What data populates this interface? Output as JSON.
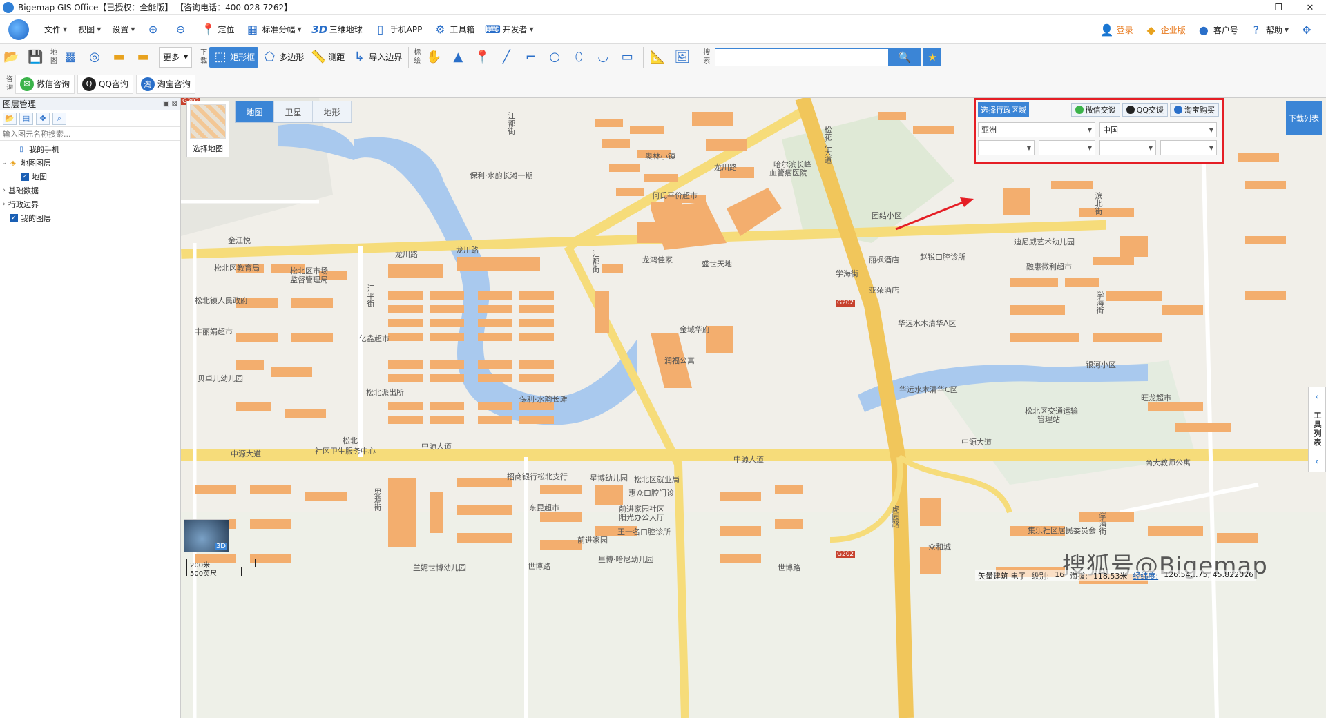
{
  "window": {
    "title": "Bigemap GIS Office【已授权：全能版】  【咨询电话：400-028-7262】",
    "buttons": [
      "—",
      "❐",
      "✕"
    ]
  },
  "menubar": {
    "items": [
      {
        "label": "文件",
        "caret": true
      },
      {
        "label": "视图",
        "caret": true
      },
      {
        "label": "设置",
        "caret": true
      }
    ],
    "tools": [
      {
        "icon": "zoom-in-icon",
        "label": ""
      },
      {
        "icon": "zoom-out-icon",
        "label": ""
      },
      {
        "icon": "location-icon",
        "label": "定位"
      },
      {
        "icon": "grid-icon",
        "label": "标准分幅"
      },
      {
        "icon": "3d-icon",
        "label": "三维地球"
      },
      {
        "icon": "phone-icon",
        "label": "手机APP"
      },
      {
        "icon": "gear-icon",
        "label": "工具箱"
      },
      {
        "icon": "code-icon",
        "label": "开发者"
      }
    ],
    "right": [
      "登录",
      "企业版",
      "客户号",
      "帮助"
    ]
  },
  "toolbar1": {
    "map_label": "地图",
    "more_label": "更多",
    "download_label": "下载",
    "mark_label": "标绘",
    "search_label": "搜索",
    "rect_label": "矩形框",
    "polygon_label": "多边形",
    "measure_label": "测距",
    "import_label": "导入边界",
    "search_placeholder": ""
  },
  "toolbar2": {
    "consult_label": "咨询",
    "wechat": "微信咨询",
    "qq": "QQ咨询",
    "taobao": "淘宝咨询"
  },
  "layer_panel": {
    "title": "图层管理",
    "search_placeholder": "输入图元名称搜索...",
    "tree": [
      {
        "label": "我的手机",
        "level": 1,
        "icon": "phone"
      },
      {
        "label": "地图图层",
        "level": 0,
        "icon": "layers",
        "expanded": true
      },
      {
        "label": "地图",
        "level": 2,
        "checked": true
      },
      {
        "label": "基础数据",
        "level": 0,
        "collapsed": true
      },
      {
        "label": "行政边界",
        "level": 0,
        "collapsed": true
      },
      {
        "label": "我的图层",
        "level": 0,
        "checked": true
      }
    ]
  },
  "map": {
    "choose_label": "选择地图",
    "tabs": [
      "地图",
      "卫星",
      "地形"
    ],
    "active_tab": "地图",
    "region": {
      "title": "选择行政区域",
      "wechat": "微信交谈",
      "qq": "QQ交谈",
      "taobao": "淘宝购买",
      "continent": "亚洲",
      "country": "中国"
    },
    "download_list": "下载列表",
    "tool_list": "工具列表",
    "globe_label": "3D",
    "scale_m": "200米",
    "scale_ft": "500英尺",
    "status": {
      "type": "矢量建筑 电子",
      "level_label": "级别:",
      "level": "16",
      "alt_label": "海拔:",
      "alt": "118.53米",
      "coord_label": "经纬度:",
      "coord": "126.54…75, 45.822026"
    },
    "watermark": "搜狐号@Bigemap",
    "labels": [
      "江都街",
      "保利·水韵长滩一期",
      "奥林小镇",
      "哈尔滨长峰",
      "血管瘤医院",
      "松花江大道",
      "何氏平价超市",
      "龙川路",
      "金江悦",
      "龙川路",
      "龙川路",
      "松北区教育局",
      "松北区市场",
      "监督管理局",
      "松北镇人民政府",
      "江平街",
      "江都街",
      "龙鸿佳家",
      "盛世天地",
      "团结小区",
      "迪尼威艺术幼儿园",
      "赵锐口腔诊所",
      "丽枫酒店",
      "融惠微利超市",
      "亚朵酒店",
      "华远水木清华A区",
      "丰丽娟超市",
      "亿鑫超市",
      "金域华府",
      "润福公寓",
      "贝卓儿幼儿园",
      "松北派出所",
      "保利·水韵长滩",
      "银河小区",
      "华远水木清华C区",
      "旺龙超市",
      "松北区交通运输",
      "管理站",
      "松北",
      "社区卫生服务中心",
      "中源大道",
      "中源大道",
      "中源大道",
      "中源大道",
      "商大教师公寓",
      "招商银行松北支行",
      "星博幼儿园",
      "松北区就业局",
      "惠众口腔门诊",
      "前进家园社区",
      "阳光办公大厅",
      "王一名口腔诊所",
      "东昆超市",
      "前进家园",
      "星博·哈尼幼儿园",
      "兰妮世博幼儿园",
      "世博路",
      "世博路",
      "众和城",
      "集乐社区居民委员会",
      "虎园路",
      "思源街",
      "滨北街",
      "学海街",
      "学海街",
      "学海街",
      "G202",
      "G202",
      "G202"
    ]
  }
}
